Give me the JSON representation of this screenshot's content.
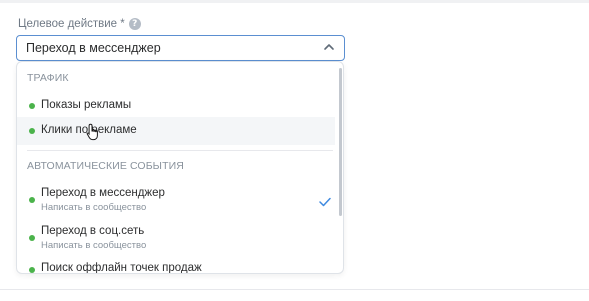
{
  "field": {
    "label": "Целевое действие *",
    "selected_value": "Переход в мессенджер"
  },
  "dropdown": {
    "groups": [
      {
        "title": "ТРАФИК",
        "items": [
          {
            "label": "Показы рекламы",
            "sublabel": "",
            "selected": false,
            "hover": false
          },
          {
            "label": "Клики по рекламе",
            "sublabel": "",
            "selected": false,
            "hover": true
          }
        ]
      },
      {
        "title": "АВТОМАТИЧЕСКИЕ СОБЫТИЯ",
        "items": [
          {
            "label": "Переход в мессенджер",
            "sublabel": "Написать в сообщество",
            "selected": true,
            "hover": false
          },
          {
            "label": "Переход в соц.сеть",
            "sublabel": "Написать в сообщество",
            "selected": false,
            "hover": false
          },
          {
            "label": "Поиск оффлайн точек продаж",
            "sublabel": "",
            "selected": false,
            "hover": false
          }
        ]
      }
    ]
  },
  "icons": {
    "help": "question-circle-icon",
    "chevron": "chevron-up-icon",
    "status_dot": "green-dot-icon",
    "check": "checkmark-icon",
    "cursor": "hand-pointer-cursor-icon"
  },
  "colors": {
    "accent": "#5b8fd1",
    "status_green": "#4bb34b",
    "check_blue": "#3f8ae0",
    "muted_text": "#8a939d"
  }
}
